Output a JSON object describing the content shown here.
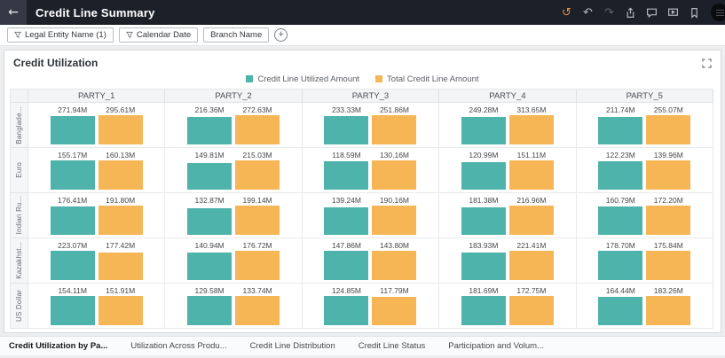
{
  "header": {
    "title": "Credit Line Summary",
    "glyphs": {
      "back": "←",
      "history": "↺",
      "undo": "↶",
      "redo": "↷"
    },
    "icons": [
      "history-icon",
      "undo-icon",
      "redo-icon",
      "share-icon",
      "comments-icon",
      "present-icon",
      "bookmark-icon",
      "profile-menu"
    ]
  },
  "filters": {
    "chips": [
      {
        "label": "Legal Entity Name (1)",
        "filter_icon": true
      },
      {
        "label": "Calendar Date",
        "filter_icon": true
      },
      {
        "label": "Branch Name",
        "filter_icon": false
      }
    ],
    "add_glyph": "+"
  },
  "panel": {
    "title": "Credit Utilization",
    "legend": [
      {
        "label": "Credit Line Utilized Amount",
        "color": "#4db3ab"
      },
      {
        "label": "Total Credit Line Amount",
        "color": "#f7b656"
      }
    ]
  },
  "chart_data": {
    "type": "bar",
    "title": "Credit Utilization",
    "series": [
      "Credit Line Utilized Amount",
      "Total Credit Line Amount"
    ],
    "series_colors": [
      "#4db3ab",
      "#f7b656"
    ],
    "columns": [
      "PARTY_1",
      "PARTY_2",
      "PARTY_3",
      "PARTY_4",
      "PARTY_5"
    ],
    "rows": [
      "Banglade...",
      "Euro",
      "Indian Ru...",
      "Kazakhst...",
      "US Dollar"
    ],
    "unit": "M",
    "legend_position": "top-center",
    "cells": [
      [
        [
          271.94,
          295.61
        ],
        [
          216.36,
          272.63
        ],
        [
          233.33,
          251.86
        ],
        [
          249.28,
          313.65
        ],
        [
          211.74,
          255.07
        ]
      ],
      [
        [
          155.17,
          160.13
        ],
        [
          149.81,
          215.03
        ],
        [
          118.59,
          130.16
        ],
        [
          120.99,
          151.11
        ],
        [
          122.23,
          139.96
        ]
      ],
      [
        [
          176.41,
          191.8
        ],
        [
          132.87,
          199.14
        ],
        [
          139.24,
          190.16
        ],
        [
          181.38,
          216.96
        ],
        [
          160.79,
          172.2
        ]
      ],
      [
        [
          223.07,
          177.42
        ],
        [
          140.94,
          176.72
        ],
        [
          147.86,
          143.8
        ],
        [
          183.93,
          221.41
        ],
        [
          178.7,
          175.84
        ]
      ],
      [
        [
          154.11,
          151.91
        ],
        [
          129.58,
          133.74
        ],
        [
          124.85,
          117.79
        ],
        [
          181.69,
          172.75
        ],
        [
          164.44,
          183.26
        ]
      ]
    ]
  },
  "tabs": [
    {
      "label": "Credit Utilization by Pa...",
      "active": true
    },
    {
      "label": "Utilization Across Produ...",
      "active": false
    },
    {
      "label": "Credit Line Distribution",
      "active": false
    },
    {
      "label": "Credit Line Status",
      "active": false
    },
    {
      "label": "Participation and Volum...",
      "active": false
    }
  ]
}
